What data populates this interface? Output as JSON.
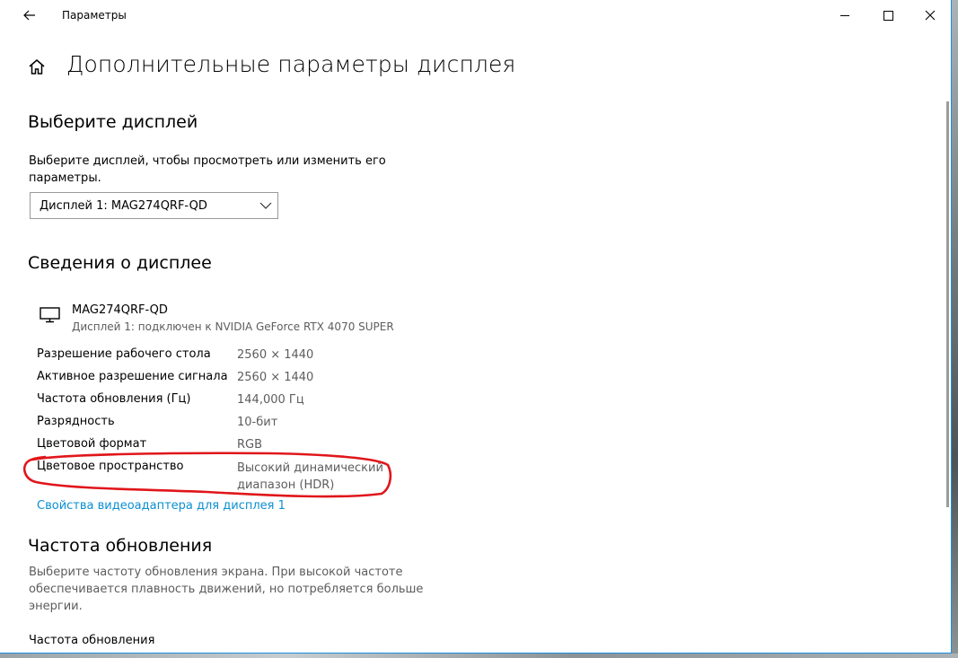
{
  "window": {
    "title": "Параметры"
  },
  "page": {
    "title": "Дополнительные параметры дисплея"
  },
  "select_display": {
    "heading": "Выберите дисплей",
    "description_line1": "Выберите дисплей, чтобы просмотреть или изменить его",
    "description_line2": "параметры.",
    "dropdown_value": "Дисплей 1: MAG274QRF-QD"
  },
  "display_info": {
    "heading": "Сведения о дисплее",
    "monitor_name": "MAG274QRF-QD",
    "monitor_subtitle": "Дисплей 1: подключен к NVIDIA GeForce RTX 4070 SUPER",
    "rows": [
      {
        "label": "Разрешение рабочего стола",
        "value": "2560 × 1440"
      },
      {
        "label": "Активное разрешение сигнала",
        "value": "2560 × 1440"
      },
      {
        "label": "Частота обновления (Гц)",
        "value": "144,000 Гц"
      },
      {
        "label": "Разрядность",
        "value": "10-бит"
      },
      {
        "label": "Цветовой формат",
        "value": "RGB"
      },
      {
        "label": "Цветовое пространство",
        "value_line1": "Высокий динамический",
        "value_line2": "диапазон (HDR)"
      }
    ],
    "adapter_link": "Свойства видеоадаптера для дисплея 1"
  },
  "refresh_rate": {
    "heading": "Частота обновления",
    "description_line1": "Выберите частоту обновления экрана. При высокой частоте",
    "description_line2": "обеспечивается плавность движений, но потребляется больше",
    "description_line3": "энергии.",
    "field_label": "Частота обновления"
  },
  "icons": {
    "back": "back-arrow-icon",
    "home": "home-icon",
    "monitor": "monitor-icon",
    "dropdown": "chevron-down-icon",
    "minimize": "minimize-icon",
    "maximize": "maximize-icon",
    "close": "close-icon"
  },
  "colors": {
    "accent_link": "#0b8fd0",
    "annotation": "#e0161b",
    "window_border": "#1a8fe0",
    "secondary_text": "#5d5d5d"
  }
}
